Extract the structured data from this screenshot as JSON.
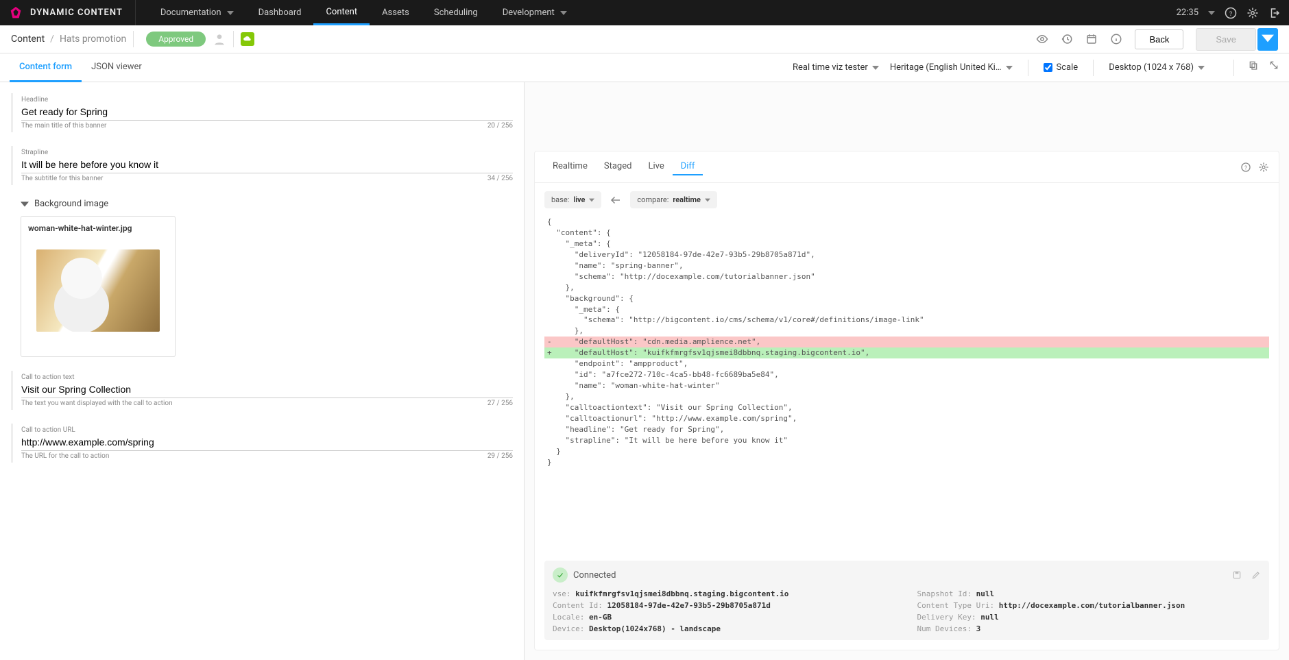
{
  "brand": "DYNAMIC CONTENT",
  "nav": {
    "items": [
      {
        "label": "Documentation",
        "dropdown": true
      },
      {
        "label": "Dashboard"
      },
      {
        "label": "Content",
        "active": true
      },
      {
        "label": "Assets"
      },
      {
        "label": "Scheduling"
      },
      {
        "label": "Development",
        "dropdown": true
      }
    ],
    "time": "22:35"
  },
  "subheader": {
    "breadcrumb_root": "Content",
    "breadcrumb_current": "Hats promotion",
    "status": "Approved",
    "back": "Back",
    "save": "Save"
  },
  "editor_tabs": {
    "form": "Content form",
    "json": "JSON viewer"
  },
  "preview_controls": {
    "viz": "Real time viz tester",
    "locale": "Heritage (English United Ki…",
    "scale_label": "Scale",
    "device": "Desktop (1024 x 768)"
  },
  "fields": {
    "headline": {
      "label": "Headline",
      "value": "Get ready for Spring",
      "hint": "The main title of this banner",
      "count": "20 / 256"
    },
    "strapline": {
      "label": "Strapline",
      "value": "It will be here before you know it",
      "hint": "The subtitle for this banner",
      "count": "34 / 256"
    },
    "bg": {
      "label": "Background image",
      "filename": "woman-white-hat-winter.jpg"
    },
    "cta_text": {
      "label": "Call to action text",
      "value": "Visit our Spring Collection",
      "hint": "The text you want displayed with the call to action",
      "count": "27 / 256"
    },
    "cta_url": {
      "label": "Call to action URL",
      "value": "http://www.example.com/spring",
      "hint": "The URL for the call to action",
      "count": "29 / 256"
    }
  },
  "preview": {
    "tabs": [
      "Realtime",
      "Staged",
      "Live",
      "Diff"
    ],
    "active_tab": "Diff",
    "base_label": "base:",
    "base_value": "live",
    "compare_label": "compare:",
    "compare_value": "realtime",
    "diff": {
      "pre": "{\n  \"content\": {\n    \"_meta\": {\n      \"deliveryId\": \"12058184-97de-42e7-93b5-29b8705a871d\",\n      \"name\": \"spring-banner\",\n      \"schema\": \"http://docexample.com/tutorialbanner.json\"\n    },\n    \"background\": {\n      \"_meta\": {\n        \"schema\": \"http://bigcontent.io/cms/schema/v1/core#/definitions/image-link\"\n      },",
      "del": "-     \"defaultHost\": \"cdn.media.amplience.net\",",
      "add": "+     \"defaultHost\": \"kuifkfmrgfsv1qjsmei8dbbnq.staging.bigcontent.io\",",
      "post": "      \"endpoint\": \"ampproduct\",\n      \"id\": \"a7fce272-710c-4ca5-bb48-fc6689ba5e84\",\n      \"name\": \"woman-white-hat-winter\"\n    },\n    \"calltoactiontext\": \"Visit our Spring Collection\",\n    \"calltoactionurl\": \"http://www.example.com/spring\",\n    \"headline\": \"Get ready for Spring\",\n    \"strapline\": \"It will be here before you know it\"\n  }\n}"
    },
    "connected": {
      "title": "Connected",
      "vse_l": "vse:",
      "vse_v": "kuifkfmrgfsv1qjsmei8dbbnq.staging.bigcontent.io",
      "cid_l": "Content Id:",
      "cid_v": "12058184-97de-42e7-93b5-29b8705a871d",
      "loc_l": "Locale:",
      "loc_v": "en-GB",
      "dev_l": "Device:",
      "dev_v": "Desktop(1024x768) - landscape",
      "snap_l": "Snapshot Id:",
      "snap_v": "null",
      "ctu_l": "Content Type Uri:",
      "ctu_v": "http://docexample.com/tutorialbanner.json",
      "dk_l": "Delivery Key:",
      "dk_v": "null",
      "nd_l": "Num Devices:",
      "nd_v": "3"
    }
  }
}
